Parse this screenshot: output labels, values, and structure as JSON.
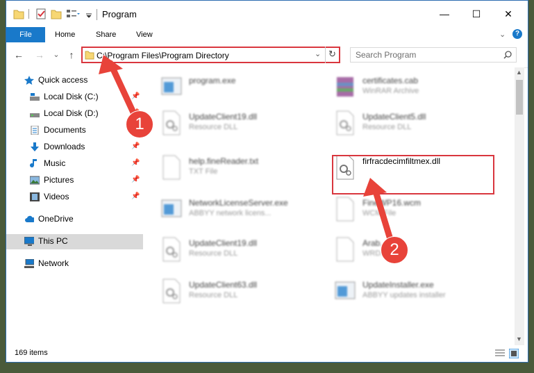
{
  "window": {
    "title": "Program"
  },
  "controls": {
    "minimize": "—",
    "maximize": "☐",
    "close": "✕"
  },
  "ribbon": {
    "file": "File",
    "tabs": [
      "Home",
      "Share",
      "View"
    ]
  },
  "nav_buttons": {
    "back": "←",
    "forward": "→",
    "recent": "⌄",
    "up": "↑"
  },
  "address": {
    "path": "C:\\Program Files\\Program Directory"
  },
  "search": {
    "placeholder": "Search Program"
  },
  "sidebar": {
    "items": [
      {
        "label": "Quick access",
        "pinned": false
      },
      {
        "label": "Local Disk (C:)",
        "pinned": true
      },
      {
        "label": "Local Disk (D:)",
        "pinned": true
      },
      {
        "label": "Documents",
        "pinned": true
      },
      {
        "label": "Downloads",
        "pinned": true
      },
      {
        "label": "Music",
        "pinned": true
      },
      {
        "label": "Pictures",
        "pinned": true
      },
      {
        "label": "Videos",
        "pinned": true
      },
      {
        "label": "OneDrive",
        "pinned": false
      },
      {
        "label": "This PC",
        "pinned": false
      },
      {
        "label": "Network",
        "pinned": false
      }
    ]
  },
  "files": [
    {
      "name": "program.exe",
      "type": ""
    },
    {
      "name": "certificates.cab",
      "type": "WinRAR Archive"
    },
    {
      "name": "UpdateClient19.dll",
      "type": "Resource DLL"
    },
    {
      "name": "UpdateClient5.dll",
      "type": "Resource DLL"
    },
    {
      "name": "help.fineReader.txt",
      "type": "TXT File"
    },
    {
      "name": "firfracdecimfiltmex.dll",
      "type": ""
    },
    {
      "name": "NetworkLicenseServer.exe",
      "type": "ABBYY network licens..."
    },
    {
      "name": "FineWP16.wcm",
      "type": "WCM File"
    },
    {
      "name": "UpdateClient19.dll",
      "type": "Resource DLL"
    },
    {
      "name": "Arab...",
      "type": "WRD..."
    },
    {
      "name": "UpdateClient63.dll",
      "type": "Resource DLL"
    },
    {
      "name": "UpdateInstaller.exe",
      "type": "ABBYY updates installer"
    }
  ],
  "status": {
    "count": "169 items"
  },
  "annotations": {
    "step1": "1",
    "step2": "2"
  },
  "colors": {
    "accent": "#1979ca",
    "highlight": "#d9363e",
    "arrow": "#e8433a"
  }
}
